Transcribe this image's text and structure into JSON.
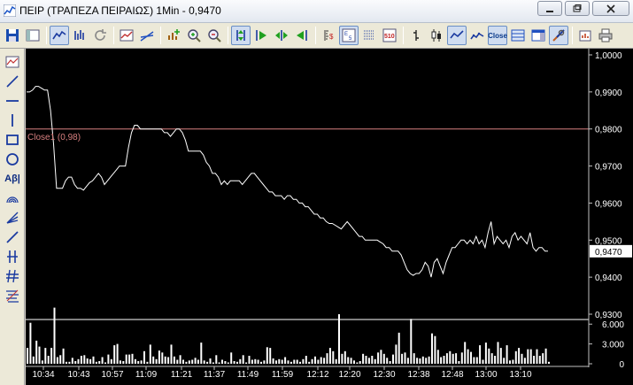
{
  "window": {
    "title": "ΠΕΙΡ (ΤΡΑΠΕΖΑ ΠΕΙΡΑΙΩΣ) 1Min - 0,9470",
    "minimize": "0",
    "maximize": "1",
    "close": "r"
  },
  "toolbar": {
    "groups": [
      [
        "save-icon",
        "layout-icon"
      ],
      [
        "line-chart-icon",
        "bar-chart-icon",
        "refresh-icon"
      ],
      [
        "indicator-icon",
        "trendline-icon"
      ],
      [
        "add-series-icon",
        "zoom-in-icon",
        "zoom-out-icon"
      ],
      [
        "scroll-start-icon",
        "play-forward-icon",
        "play-both-icon",
        "play-back-icon"
      ],
      [
        "price-scale-icon",
        "numeric-scale-icon",
        "grid-icon",
        "scale-510-icon"
      ],
      [
        "ohlc-bar-icon",
        "candlestick-icon",
        "line-style-icon",
        "close-style-icon"
      ],
      [
        "panel-icon",
        "window-icon",
        "tools-icon"
      ],
      [
        "export-icon",
        "print-icon"
      ]
    ],
    "close_label": "Close",
    "scale_label_a": "5/10",
    "scale_label_b": "5 10"
  },
  "sidetools": [
    "chart-type-icon",
    "line-tool-icon",
    "horizontal-line-icon",
    "vertical-line-icon",
    "rectangle-icon",
    "ellipse-icon",
    "text-tool-icon",
    "arc-icon",
    "fan-icon",
    "ray-icon",
    "parallel-icon",
    "channel-icon",
    "fibonacci-icon"
  ],
  "colors": {
    "background": "#000000",
    "price_line": "#ffffff",
    "reference_line": "#d88080",
    "volume_bars": "#ffffff",
    "axis": "#c0c0c0"
  },
  "chart_data": {
    "type": "line",
    "x_ticks": [
      "10:34",
      "10:43",
      "10:57",
      "11:09",
      "11:21",
      "11:37",
      "11:49",
      "11:59",
      "12:12",
      "12:20",
      "12:30",
      "12:38",
      "12:48",
      "13:00",
      "13:10"
    ],
    "price_axis": {
      "ticks": [
        "1,0000",
        "0,9900",
        "0,9800",
        "0,9700",
        "0,9600",
        "0,9500",
        "0,9400",
        "0,9300"
      ],
      "ylim": [
        0.93,
        1.0
      ]
    },
    "volume_axis": {
      "ticks": [
        "6.000",
        "3.000",
        "0"
      ],
      "ylim": [
        0,
        6700
      ]
    },
    "reference_line": {
      "label": "Close1 (0,98)",
      "value": 0.98
    },
    "last_price_label": "0,9470",
    "last_price": 0.947,
    "series": [
      {
        "kind": "price",
        "values": [
          0.99,
          0.99,
          0.9905,
          0.9915,
          0.9915,
          0.991,
          0.9905,
          0.9905,
          0.985,
          0.976,
          0.964,
          0.964,
          0.964,
          0.966,
          0.967,
          0.967,
          0.965,
          0.964,
          0.964,
          0.9635,
          0.9645,
          0.9655,
          0.966,
          0.967,
          0.968,
          0.967,
          0.965,
          0.966,
          0.967,
          0.968,
          0.969,
          0.97,
          0.97,
          0.97,
          0.975,
          0.979,
          0.981,
          0.981,
          0.98,
          0.98,
          0.98,
          0.98,
          0.98,
          0.98,
          0.98,
          0.98,
          0.979,
          0.979,
          0.978,
          0.979,
          0.98,
          0.98,
          0.979,
          0.977,
          0.974,
          0.974,
          0.974,
          0.974,
          0.974,
          0.973,
          0.971,
          0.97,
          0.968,
          0.968,
          0.967,
          0.965,
          0.966,
          0.965,
          0.966,
          0.966,
          0.966,
          0.966,
          0.965,
          0.966,
          0.967,
          0.968,
          0.968,
          0.967,
          0.966,
          0.965,
          0.964,
          0.963,
          0.963,
          0.962,
          0.962,
          0.962,
          0.961,
          0.962,
          0.962,
          0.961,
          0.961,
          0.96,
          0.96,
          0.959,
          0.959,
          0.958,
          0.957,
          0.957,
          0.956,
          0.956,
          0.955,
          0.9545,
          0.9545,
          0.954,
          0.9535,
          0.953,
          0.954,
          0.955,
          0.954,
          0.953,
          0.952,
          0.951,
          0.951,
          0.95,
          0.95,
          0.95,
          0.95,
          0.95,
          0.9495,
          0.949,
          0.948,
          0.948,
          0.947,
          0.947,
          0.947,
          0.946,
          0.944,
          0.942,
          0.941,
          0.9405,
          0.941,
          0.941,
          0.942,
          0.944,
          0.943,
          0.94,
          0.944,
          0.945,
          0.943,
          0.941,
          0.944,
          0.946,
          0.948,
          0.948,
          0.949,
          0.95,
          0.95,
          0.949,
          0.95,
          0.949,
          0.951,
          0.949,
          0.95,
          0.948,
          0.952,
          0.955,
          0.949,
          0.951,
          0.95,
          0.949,
          0.95,
          0.948,
          0.951,
          0.952,
          0.95,
          0.951,
          0.95,
          0.949,
          0.952,
          0.948,
          0.947,
          0.948,
          0.948,
          0.947,
          0.947
        ]
      },
      {
        "kind": "volume",
        "values": [
          2400,
          6200,
          1100,
          3500,
          2600,
          500,
          2400,
          1200,
          2400,
          8500,
          1000,
          1300,
          2300,
          300,
          300,
          900,
          400,
          700,
          1200,
          1300,
          800,
          700,
          1100,
          300,
          400,
          1000,
          200,
          1400,
          700,
          2800,
          3000,
          500,
          400,
          1400,
          1400,
          1500,
          700,
          400,
          500,
          1900,
          300,
          2900,
          1100,
          700,
          2000,
          1700,
          1100,
          1000,
          2900,
          1100,
          600,
          1300,
          600,
          300,
          500,
          600,
          900,
          600,
          3200,
          500,
          300,
          800,
          200,
          1300,
          200,
          600,
          400,
          200,
          1700,
          400,
          300,
          700,
          1300,
          200,
          1200,
          600,
          700,
          600,
          300,
          500,
          2500,
          2400,
          800,
          500,
          700,
          600,
          1000,
          500,
          300,
          600,
          600,
          300,
          700,
          1200,
          300,
          700,
          1100,
          600,
          1000,
          900,
          1600,
          2400,
          1900,
          700,
          7500,
          1500,
          1900,
          1000,
          900,
          500,
          200,
          400,
          1500,
          1200,
          900,
          1200,
          700,
          1700,
          2100,
          1500,
          900,
          400,
          1400,
          2900,
          4700,
          1500,
          1700,
          900,
          6800,
          1600,
          900,
          800,
          1100,
          900,
          1100,
          4600,
          4200,
          2100,
          1000,
          1200,
          1600,
          1900,
          1500,
          1600,
          400,
          1700,
          3300,
          2200,
          1800,
          1000,
          1000,
          2800,
          600,
          3200,
          2300,
          1600,
          1200,
          3300,
          2400,
          900,
          2800,
          500,
          600,
          1900,
          2400,
          1500,
          900,
          2200,
          2200,
          1200,
          2200,
          1200,
          1600,
          2300,
          300
        ]
      }
    ]
  }
}
